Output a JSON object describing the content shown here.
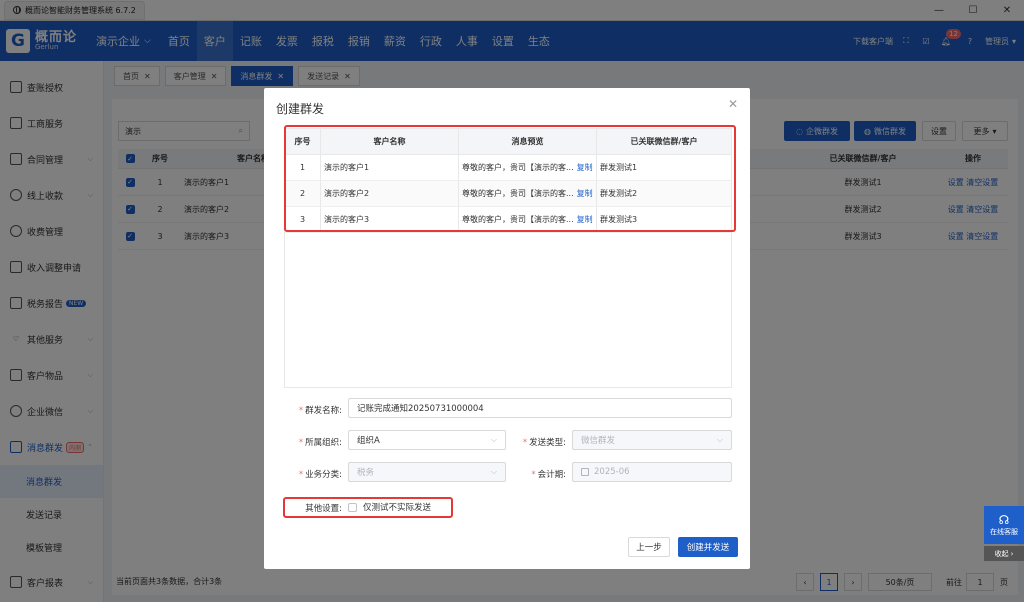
{
  "window": {
    "tab_title": "概而论智能财务管理系统 6.7.2"
  },
  "topnav": {
    "logo_cn": "概而论",
    "logo_en": "Gerlun",
    "company": "演示企业",
    "items": [
      "首页",
      "客户",
      "记账",
      "发票",
      "报税",
      "报销",
      "薪资",
      "行政",
      "人事",
      "设置",
      "生态"
    ],
    "download": "下载客户端",
    "notify_count": "12",
    "user": "管理员"
  },
  "sidebar": {
    "items": [
      {
        "label": "查账授权"
      },
      {
        "label": "工商服务"
      },
      {
        "label": "合同管理"
      },
      {
        "label": "线上收款"
      },
      {
        "label": "收费管理"
      },
      {
        "label": "收入调整申请"
      },
      {
        "label": "税务报告",
        "tag": "NEW"
      },
      {
        "label": "其他服务"
      },
      {
        "label": "客户物品"
      },
      {
        "label": "企业微信"
      },
      {
        "label": "消息群发",
        "tag": "内测"
      }
    ],
    "subitems": [
      "消息群发",
      "发送记录",
      "模板管理"
    ],
    "last_item": "客户报表"
  },
  "page_tabs": [
    "首页",
    "客户管理",
    "消息群发",
    "发送记录"
  ],
  "main": {
    "search_value": "演示",
    "btn_enterprise": "企微群发",
    "btn_wechat": "微信群发",
    "btn_settings": "设置",
    "btn_more": "更多",
    "head_no": "序号",
    "head_name": "客户名称",
    "head_linked": "已关联微信群/客户",
    "head_action": "操作",
    "rows": [
      {
        "no": "1",
        "name": "演示的客户1",
        "linked": "群发测试1"
      },
      {
        "no": "2",
        "name": "演示的客户2",
        "linked": "群发测试2"
      },
      {
        "no": "3",
        "name": "演示的客户3",
        "linked": "群发测试3"
      }
    ],
    "action_set": "设置",
    "action_clear": "清空设置",
    "footer_text": "当前页面共3条数据，合计3条",
    "page_current": "1",
    "page_size": "50条/页",
    "goto_label": "前往",
    "goto_value": "1",
    "page_suffix": "页"
  },
  "dialog": {
    "title": "创建群发",
    "table_headers": [
      "序号",
      "客户名称",
      "消息预览",
      "已关联微信群/客户"
    ],
    "rows": [
      {
        "no": "1",
        "name": "演示的客户1",
        "preview": "尊敬的客户，贵司【演示的客...",
        "copy": "复制",
        "linked": "群发测试1"
      },
      {
        "no": "2",
        "name": "演示的客户2",
        "preview": "尊敬的客户，贵司【演示的客...",
        "copy": "复制",
        "linked": "群发测试2"
      },
      {
        "no": "3",
        "name": "演示的客户3",
        "preview": "尊敬的客户，贵司【演示的客...",
        "copy": "复制",
        "linked": "群发测试3"
      }
    ],
    "form": {
      "name_label": "群发名称:",
      "name_value": "记账完成通知20250731000004",
      "org_label": "所属组织:",
      "org_value": "组织A",
      "send_type_label": "发送类型:",
      "send_type_value": "微信群发",
      "biz_label": "业务分类:",
      "biz_value": "税务",
      "period_label": "会计期:",
      "period_value": "2025-06",
      "other_label": "其他设置:",
      "test_only_label": "仅测试不实际发送"
    },
    "btn_prev": "上一步",
    "btn_create": "创建并发送"
  },
  "float": {
    "help": "在线客服",
    "collapse": "收起"
  },
  "colors": {
    "brand": "#1f5fc9",
    "highlight_box": "#e53935"
  }
}
